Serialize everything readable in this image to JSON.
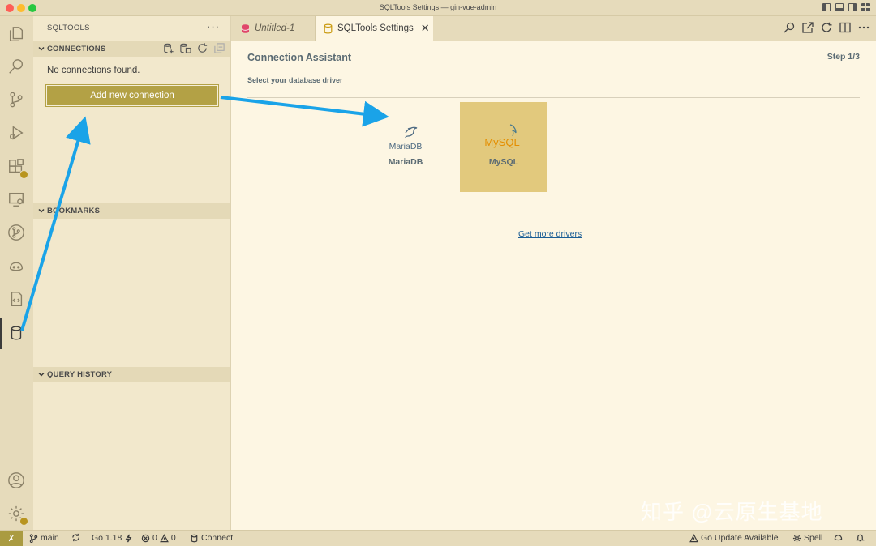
{
  "window": {
    "title": "SQLTools Settings — gin-vue-admin"
  },
  "sidebar": {
    "title": "SQLTOOLS",
    "more": "···",
    "sections": {
      "connections": "CONNECTIONS",
      "bookmarks": "BOOKMARKS",
      "query_history": "QUERY HISTORY"
    },
    "empty_message": "No connections found.",
    "add_button": "Add new connection"
  },
  "tabs": [
    {
      "label": "Untitled-1"
    },
    {
      "label": "SQLTools Settings",
      "close": "✕"
    }
  ],
  "assistant": {
    "title": "Connection Assistant",
    "step": "Step 1/3",
    "subtitle": "Select your database driver",
    "drivers": [
      {
        "name": "MariaDB",
        "logo_text": "MariaDB"
      },
      {
        "name": "MySQL",
        "logo_text": "MySQL"
      }
    ],
    "more_link": "Get more drivers"
  },
  "statusbar": {
    "remote": "✗",
    "branch": "main",
    "go_version": "Go 1.18",
    "errors": "0",
    "warnings": "0",
    "connect": "Connect",
    "go_update": "Go Update Available",
    "spell": "Spell"
  },
  "watermark": "知乎 @云原生基地",
  "colors": {
    "accent_button": "#b3a145",
    "selected_driver": "#e2c97d",
    "link": "#1a5d95",
    "annotation_arrow": "#1aa3e8"
  }
}
